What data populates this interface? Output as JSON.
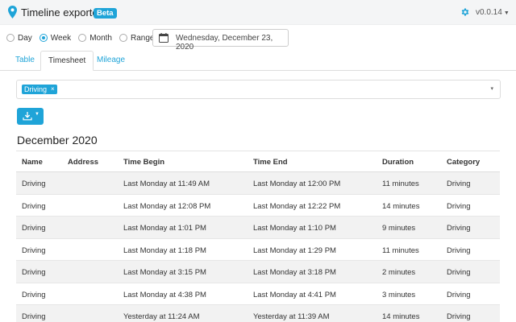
{
  "header": {
    "title": "Timeline exporter",
    "badge": "Beta",
    "version": "v0.0.14",
    "caret": "▼",
    "accent": "#1fa4d8",
    "icons": [
      "map-pin-icon",
      "gear-icon"
    ]
  },
  "range": {
    "options": [
      "Day",
      "Week",
      "Month",
      "Range"
    ],
    "selected": "Week",
    "date": "Wednesday, December 23, 2020"
  },
  "tabs": [
    {
      "label": "Table",
      "active": false
    },
    {
      "label": "Timesheet",
      "active": true
    },
    {
      "label": "Mileage",
      "active": false
    }
  ],
  "filter": {
    "chip": "Driving",
    "chip_remove": "×",
    "caret": "▾"
  },
  "download": {
    "icon": "download-icon",
    "caret": "▼"
  },
  "section_title": "December 2020",
  "table": {
    "columns": [
      "Name",
      "Address",
      "Time Begin",
      "Time End",
      "Duration",
      "Category"
    ],
    "rows": [
      [
        "Driving",
        "",
        "Last Monday at 11:49 AM",
        "Last Monday at 12:00 PM",
        "11 minutes",
        "Driving"
      ],
      [
        "Driving",
        "",
        "Last Monday at 12:08 PM",
        "Last Monday at 12:22 PM",
        "14 minutes",
        "Driving"
      ],
      [
        "Driving",
        "",
        "Last Monday at 1:01 PM",
        "Last Monday at 1:10 PM",
        "9 minutes",
        "Driving"
      ],
      [
        "Driving",
        "",
        "Last Monday at 1:18 PM",
        "Last Monday at 1:29 PM",
        "11 minutes",
        "Driving"
      ],
      [
        "Driving",
        "",
        "Last Monday at 3:15 PM",
        "Last Monday at 3:18 PM",
        "2 minutes",
        "Driving"
      ],
      [
        "Driving",
        "",
        "Last Monday at 4:38 PM",
        "Last Monday at 4:41 PM",
        "3 minutes",
        "Driving"
      ],
      [
        "Driving",
        "",
        "Yesterday at 11:24 AM",
        "Yesterday at 11:39 AM",
        "14 minutes",
        "Driving"
      ]
    ]
  }
}
